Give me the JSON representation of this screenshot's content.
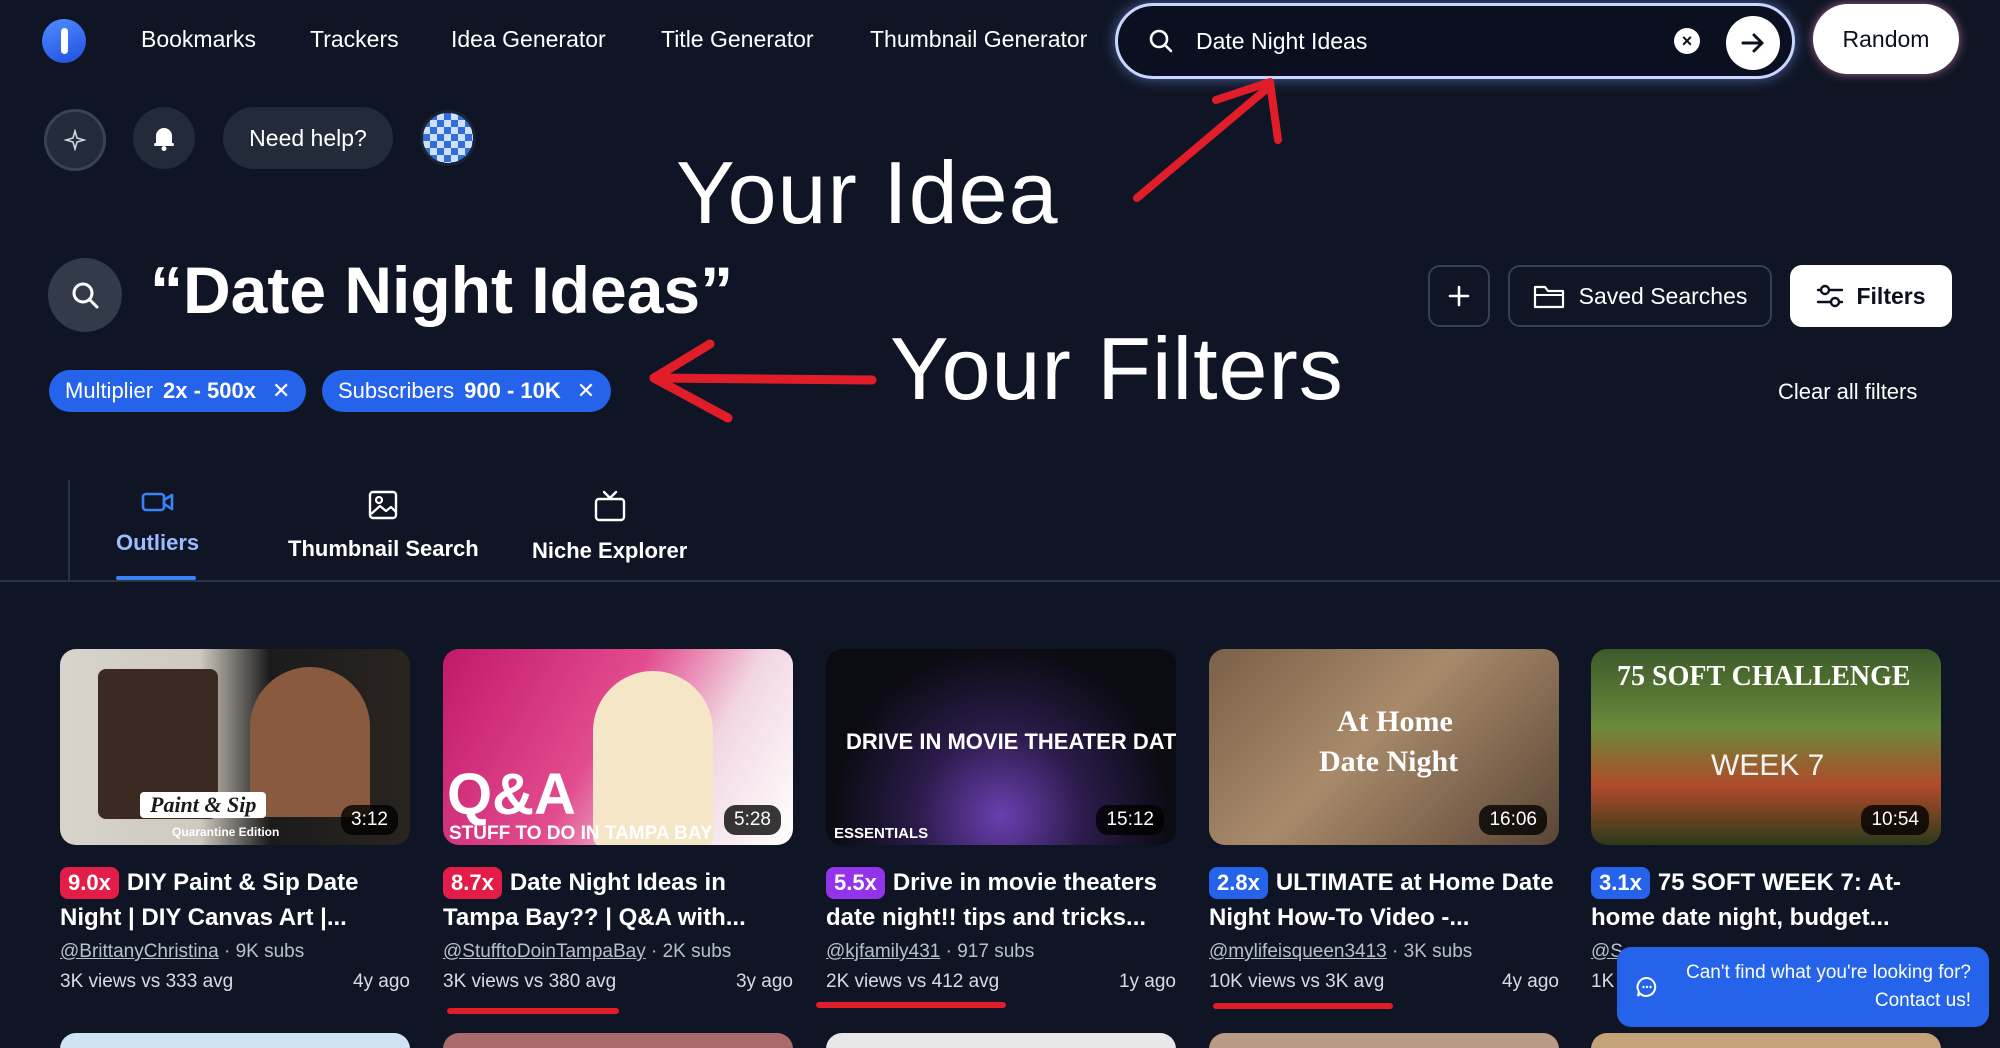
{
  "nav": {
    "links": [
      "Bookmarks",
      "Trackers",
      "Idea Generator",
      "Title Generator",
      "Thumbnail Generator"
    ],
    "search_value": "Date Night Ideas",
    "random_label": "Random"
  },
  "toolbar": {
    "help_label": "Need help?"
  },
  "annotations": {
    "idea": "Your Idea",
    "filters": "Your Filters"
  },
  "query": {
    "title": "“Date Night Ideas”",
    "saved_searches_label": "Saved Searches",
    "filters_label": "Filters"
  },
  "filters": {
    "chips": [
      {
        "label": "Multiplier",
        "value": "2x - 500x"
      },
      {
        "label": "Subscribers",
        "value": "900 - 10K"
      }
    ],
    "clear_label": "Clear all filters"
  },
  "tabs": [
    {
      "label": "Outliers",
      "icon": "video-camera-icon"
    },
    {
      "label": "Thumbnail Search",
      "icon": "image-icon"
    },
    {
      "label": "Niche Explorer",
      "icon": "tv-icon"
    }
  ],
  "videos": [
    {
      "multiplier": "9.0x",
      "mult_color": "#e11d48",
      "title": "DIY Paint & Sip Date Night | DIY Canvas Art |...",
      "channel": "@BrittanyChristina",
      "subs": "9K subs",
      "stats": "3K views vs 333 avg",
      "age": "4y ago",
      "duration": "3:12",
      "thumb_text": "Paint & Sip",
      "thumb_subtext": "Quarantine Edition"
    },
    {
      "multiplier": "8.7x",
      "mult_color": "#e11d48",
      "title": "Date Night Ideas in Tampa Bay?? | Q&A with...",
      "channel": "@StufftoDoinTampaBay",
      "subs": "2K subs",
      "stats": "3K views vs 380 avg",
      "age": "3y ago",
      "duration": "5:28",
      "thumb_text": "Q&A",
      "thumb_subtext": "STUFF TO DO IN TAMPA BAY"
    },
    {
      "multiplier": "5.5x",
      "mult_color": "#9333ea",
      "title": "Drive in movie theaters date night!! tips and tricks...",
      "channel": "@kjfamily431",
      "subs": "917 subs",
      "stats": "2K views vs 412 avg",
      "age": "1y ago",
      "duration": "15:12",
      "thumb_text": "DRIVE IN MOVIE THEATER DATE NIGHT!",
      "thumb_subtext": "ESSENTIALS"
    },
    {
      "multiplier": "2.8x",
      "mult_color": "#2563eb",
      "title": "ULTIMATE at Home Date Night How-To Video -...",
      "channel": "@mylifeisqueen3413",
      "subs": "3K subs",
      "stats": "10K views vs 3K avg",
      "age": "4y ago",
      "duration": "16:06",
      "thumb_text": "At Home",
      "thumb_subtext": "Date Night"
    },
    {
      "multiplier": "3.1x",
      "mult_color": "#2563eb",
      "title": "75 SOFT WEEK 7: At-home date night, budget...",
      "channel": "@S",
      "subs": "",
      "stats": "1K v",
      "age": "",
      "duration": "10:54",
      "thumb_text": "75 SOFT CHALLENGE",
      "thumb_subtext": "WEEK 7"
    }
  ],
  "contact": {
    "line1": "Can't find what you're looking for?",
    "line2": "Contact us!"
  },
  "colors": {
    "background": "#0f1524",
    "accent": "#2563eb",
    "annotation_red": "#e11d2a"
  }
}
